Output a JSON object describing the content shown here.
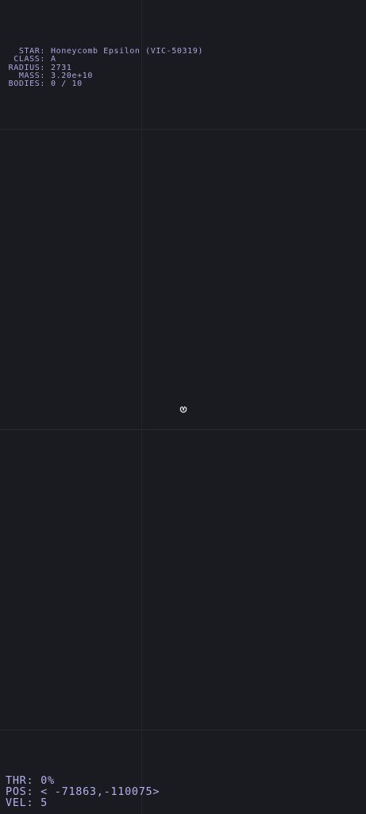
{
  "star": {
    "name_label": "STAR:",
    "name_value": "Honeycomb Epsilon (VIC-50319)",
    "class_label": "CLASS:",
    "class_value": "A",
    "radius_label": "RADIUS:",
    "radius_value": "2731",
    "mass_label": "MASS:",
    "mass_value": "3.20e+10",
    "bodies_label": "BODIES:",
    "bodies_value": "0 / 10"
  },
  "hud": {
    "thrust_label": "THR:",
    "thrust_value": "0%",
    "position_label": "POS:",
    "position_value": "< -71863,-110075>",
    "velocity_label": "VEL:",
    "velocity_value": "5"
  },
  "ship": {
    "icon": "ship-icon",
    "color": "#e8e8f0"
  },
  "colors": {
    "background": "#1a1b21",
    "grid": "#24262f",
    "text": "#a9a6e0"
  }
}
